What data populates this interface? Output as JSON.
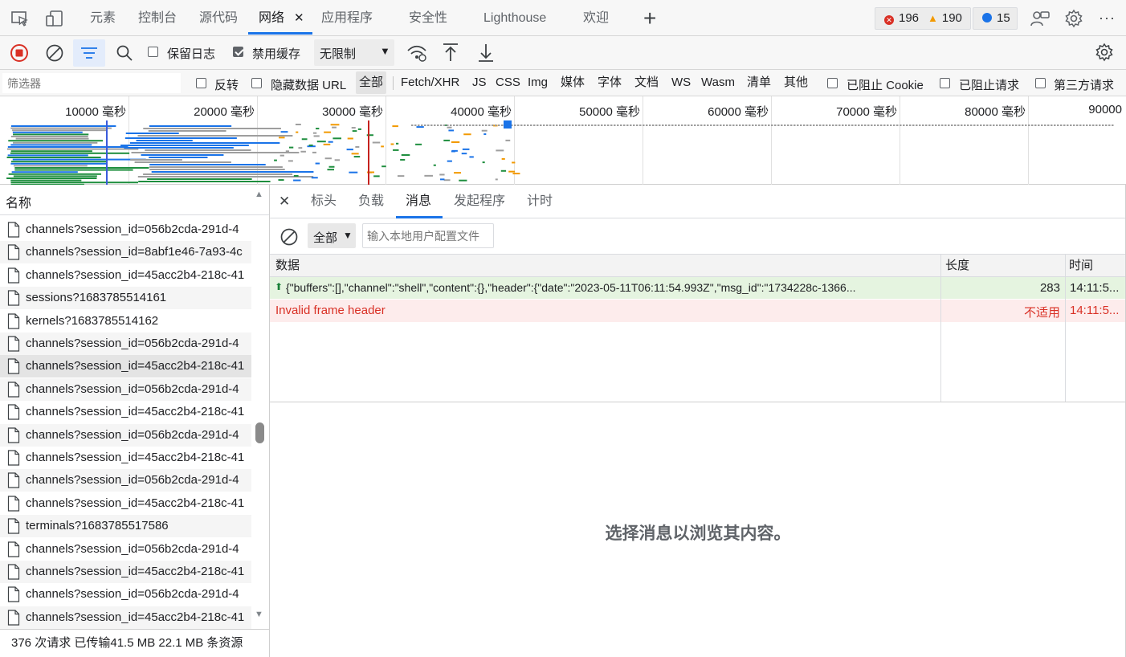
{
  "tabs": [
    {
      "label": "元素"
    },
    {
      "label": "控制台"
    },
    {
      "label": "源代码"
    },
    {
      "label": "网络"
    },
    {
      "label": "应用程序"
    },
    {
      "label": "安全性"
    },
    {
      "label": "Lighthouse"
    },
    {
      "label": "欢迎"
    }
  ],
  "tab_close_glyph": "✕",
  "new_tab_glyph": "+",
  "counters": {
    "errors": "196",
    "warnings": "190",
    "messages": "15"
  },
  "more_glyph": "···",
  "toolbar": {
    "preserve_log": "保留日志",
    "disable_cache": "禁用缓存",
    "throttle": "无限制"
  },
  "filter": {
    "placeholder": "筛选器",
    "invert": "反转",
    "hide_data_url": "隐藏数据 URL",
    "types": [
      "全部",
      "Fetch/XHR",
      "JS",
      "CSS",
      "Img",
      "媒体",
      "字体",
      "文档",
      "WS",
      "Wasm",
      "清单",
      "其他"
    ],
    "blocked_cookies": "已阻止 Cookie",
    "blocked_requests": "已阻止请求",
    "third_party": "第三方请求"
  },
  "timeline_ticks": [
    "10000 毫秒",
    "20000 毫秒",
    "30000 毫秒",
    "40000 毫秒",
    "50000 毫秒",
    "60000 毫秒",
    "70000 毫秒",
    "80000 毫秒",
    "90000"
  ],
  "request_list": {
    "header": "名称",
    "rows": [
      "channels?session_id=056b2cda-291d-4",
      "channels?session_id=8abf1e46-7a93-4c",
      "channels?session_id=45acc2b4-218c-41",
      "sessions?1683785514161",
      "kernels?1683785514162",
      "channels?session_id=056b2cda-291d-4",
      "channels?session_id=45acc2b4-218c-41",
      "channels?session_id=056b2cda-291d-4",
      "channels?session_id=45acc2b4-218c-41",
      "channels?session_id=056b2cda-291d-4",
      "channels?session_id=45acc2b4-218c-41",
      "channels?session_id=056b2cda-291d-4",
      "channels?session_id=45acc2b4-218c-41",
      "terminals?1683785517586",
      "channels?session_id=056b2cda-291d-4",
      "channels?session_id=45acc2b4-218c-41",
      "channels?session_id=056b2cda-291d-4",
      "channels?session_id=45acc2b4-218c-41"
    ],
    "selected_index": 6
  },
  "status_bar": "376 次请求   已传输41.5 MB   22.1 MB 条资源",
  "detail_tabs": [
    "标头",
    "负载",
    "消息",
    "发起程序",
    "计时"
  ],
  "messages": {
    "filter_option": "全部",
    "filter_placeholder": "输入本地用户配置文件",
    "columns": {
      "data": "数据",
      "length": "长度",
      "time": "时间"
    },
    "rows": [
      {
        "arrow": "⬆",
        "data": "{\"buffers\":[],\"channel\":\"shell\",\"content\":{},\"header\":{\"date\":\"2023-05-11T06:11:54.993Z\",\"msg_id\":\"1734228c-1366...",
        "length": "283",
        "time": "14:11:5...",
        "kind": "sent"
      },
      {
        "arrow": "",
        "data": "Invalid frame header",
        "length": "不适用",
        "time": "14:11:5...",
        "kind": "error"
      }
    ],
    "empty_hint": "选择消息以浏览其内容。"
  },
  "colors": {
    "accent": "#1a73e8",
    "record_red": "#d93025",
    "sent_bg": "#e5f4e0",
    "error_bg": "#fdecec",
    "error_text": "#d93025"
  }
}
